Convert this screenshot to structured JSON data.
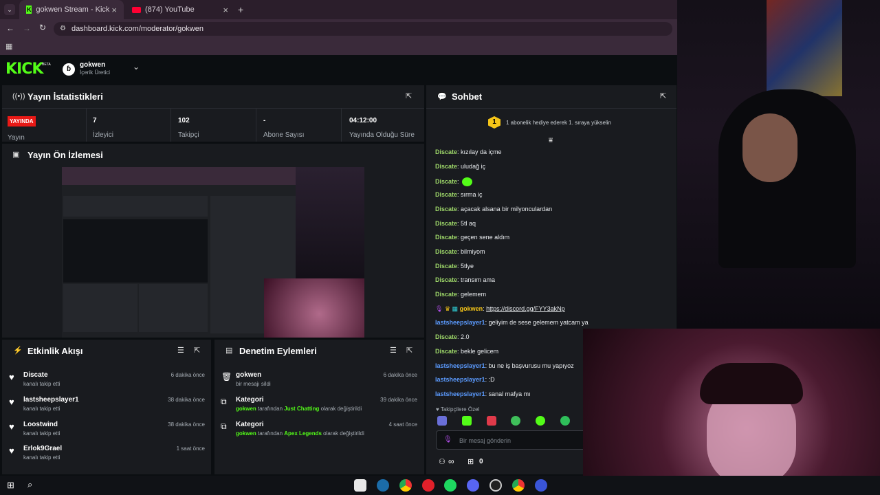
{
  "browser": {
    "tabs": [
      {
        "title": "gokwen Stream - Kick Dashboard"
      },
      {
        "title": "(874) YouTube"
      }
    ],
    "url": "dashboard.kick.com/moderator/gokwen"
  },
  "header": {
    "logo": "KICK",
    "logo_badge": "BETA",
    "channel_name": "gokwen",
    "channel_role": "İçerik Üretici"
  },
  "stats": {
    "title": "Yayın İstatistikleri",
    "live_badge": "YAYINDA",
    "live_label": "Yayın",
    "items": [
      {
        "value": "7",
        "label": "İzleyici"
      },
      {
        "value": "102",
        "label": "Takipçi"
      },
      {
        "value": "-",
        "label": "Abone Sayısı"
      },
      {
        "value": "04:12:00",
        "label": "Yayında Olduğu Süre"
      }
    ]
  },
  "preview": {
    "title": "Yayın Ön İzlemesi"
  },
  "activity": {
    "title": "Etkinlik Akışı",
    "items": [
      {
        "name": "Discate",
        "sub": "kanalı takip etti",
        "time": "6 dakika önce"
      },
      {
        "name": "lastsheepslayer1",
        "sub": "kanalı takip etti",
        "time": "38 dakika önce"
      },
      {
        "name": "Loostwind",
        "sub": "kanalı takip etti",
        "time": "38 dakika önce"
      },
      {
        "name": "Erlok9Grael",
        "sub": "kanalı takip etti",
        "time": "1 saat önce"
      }
    ]
  },
  "moderation": {
    "title": "Denetim Eylemleri",
    "items": [
      {
        "name": "gokwen",
        "sub": "bir mesajı sildi",
        "time": "6 dakika önce"
      },
      {
        "name": "Kategori",
        "actor": "gokwen",
        "mid": " tarafından ",
        "target": "Just Chatting",
        "tail": " olarak değiştirildi",
        "time": "39 dakika önce"
      },
      {
        "name": "Kategori",
        "actor": "gokwen",
        "mid": " tarafından ",
        "target": "Apex Legends",
        "tail": " olarak değiştirildi",
        "time": "4 saat önce"
      }
    ]
  },
  "chat": {
    "title": "Sohbet",
    "gift_rank": "1",
    "gift_text": "1 abonelik hediye ederek 1. sıraya yükselin",
    "messages": [
      {
        "user": "Discate",
        "text": "kızılay da içme"
      },
      {
        "user": "Discate",
        "text": "uludağ iç"
      },
      {
        "user": "Discate",
        "text": ""
      },
      {
        "user": "Discate",
        "text": "sırma iç"
      },
      {
        "user": "Discate",
        "text": "açacak alsana bir milyonculardan"
      },
      {
        "user": "Discate",
        "text": "5tl aq"
      },
      {
        "user": "Discate",
        "text": "geçen sene aldım"
      },
      {
        "user": "Discate",
        "text": "bilmiyom"
      },
      {
        "user": "Discate",
        "text": "5tlye"
      },
      {
        "user": "Discate",
        "text": "transım ama"
      },
      {
        "user": "Discate",
        "text": "gelemem"
      },
      {
        "user": "gokwen",
        "text": "https://discord.gg/FYY3akNp"
      },
      {
        "user": "lastsheepslayer1",
        "text": "geliyim de sese gelemem yatcam ya"
      },
      {
        "user": "Discate",
        "text": "2.0"
      },
      {
        "user": "Discate",
        "text": "bekle gelicem"
      },
      {
        "user": "lastsheepslayer1",
        "text": "bu ne iş başvurusu mu yapıyoz"
      },
      {
        "user": "lastsheepslayer1",
        "text": ":D"
      },
      {
        "user": "lastsheepslayer1",
        "text": "sanal mafya mı"
      }
    ],
    "followers_only": "Takipçilere Özel",
    "input_placeholder": "Bir mesaj gönderin",
    "infinity": "∞",
    "gift_count": "0"
  },
  "colors": {
    "brand_green": "#53fc18",
    "live_red": "#e91916",
    "panel": "#191b1f",
    "background": "#0b0e11"
  }
}
